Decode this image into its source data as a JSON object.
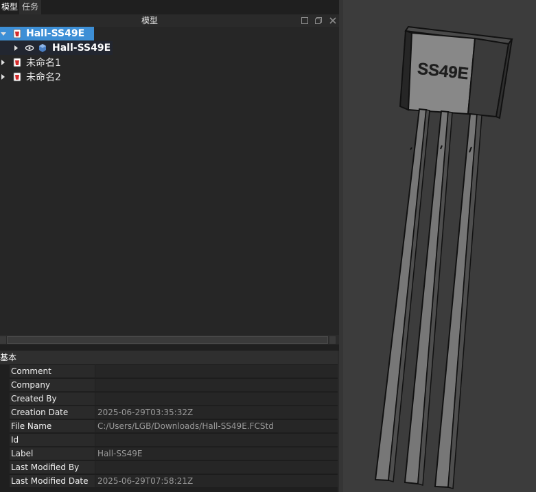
{
  "tabs": [
    {
      "label": "模型"
    },
    {
      "label": "任务"
    }
  ],
  "dock": {
    "title": "模型"
  },
  "tree": {
    "items": [
      {
        "label": "Hall-SS49E"
      },
      {
        "label": "Hall-SS49E"
      },
      {
        "label": "未命名1"
      },
      {
        "label": "未命名2"
      }
    ]
  },
  "properties": {
    "group": "基本",
    "rows": [
      {
        "name": "Comment",
        "value": ""
      },
      {
        "name": "Company",
        "value": ""
      },
      {
        "name": "Created By",
        "value": ""
      },
      {
        "name": "Creation Date",
        "value": "2025-06-29T03:35:32Z"
      },
      {
        "name": "File Name",
        "value": "C:/Users/LGB/Downloads/Hall-SS49E.FCStd"
      },
      {
        "name": "Id",
        "value": ""
      },
      {
        "name": "Label",
        "value": "Hall-SS49E"
      },
      {
        "name": "Last Modified By",
        "value": ""
      },
      {
        "name": "Last Modified Date",
        "value": "2025-06-29T07:58:21Z"
      }
    ]
  },
  "viewer": {
    "component_marking": "SS49E"
  },
  "colors": {
    "selection": "#3d8fd6",
    "background": "#1f1f1f",
    "viewport": "#3c3c3c"
  }
}
